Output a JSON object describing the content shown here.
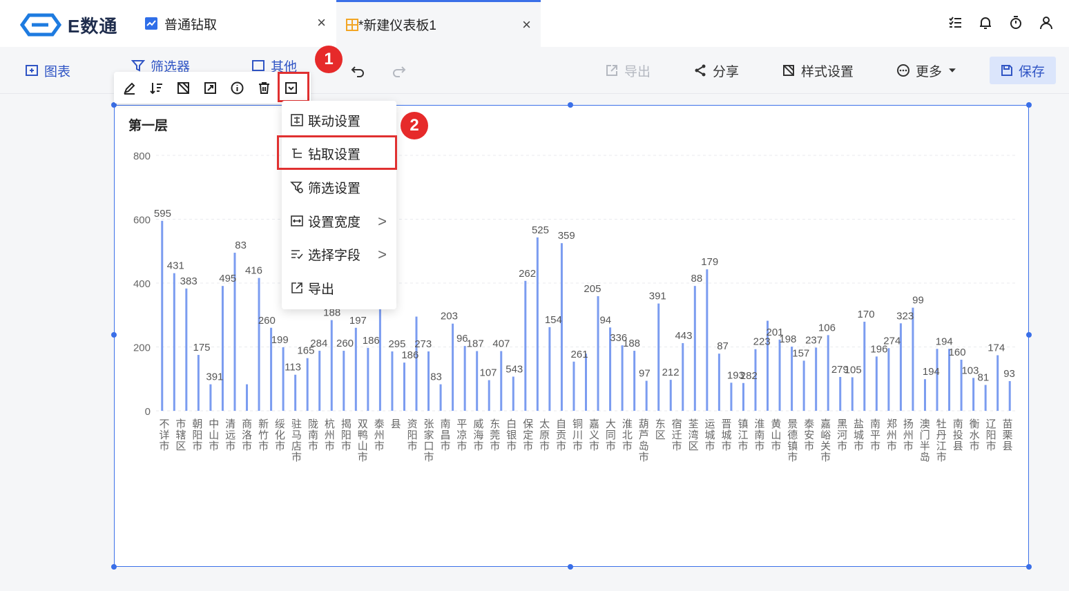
{
  "app": {
    "logo_text": "E数通"
  },
  "tabs": [
    {
      "label": "普通钻取",
      "close": "×"
    },
    {
      "label": "*新建仪表板1",
      "close": "×"
    }
  ],
  "toolbar": {
    "chart": "图表",
    "filter": "筛选器",
    "other": "其他",
    "export": "导出",
    "share": "分享",
    "style": "样式设置",
    "more": "更多",
    "save": "保存"
  },
  "menu": {
    "items": [
      {
        "label": "联动设置",
        "submenu": false
      },
      {
        "label": "钻取设置",
        "submenu": false
      },
      {
        "label": "筛选设置",
        "submenu": false
      },
      {
        "label": "设置宽度",
        "submenu": true
      },
      {
        "label": "选择字段",
        "submenu": true
      },
      {
        "label": "导出",
        "submenu": false
      }
    ],
    "arrow": ">"
  },
  "badges": [
    "1",
    "2"
  ],
  "colors": {
    "accent": "#3a6fe8",
    "bar": "#7b9cf0",
    "highlight": "#e03030",
    "badge": "#e62a2a"
  },
  "chart_data": {
    "type": "bar",
    "title": "第一层",
    "ylim": [
      0,
      800
    ],
    "yticks": [
      0,
      200,
      400,
      600,
      800
    ],
    "grid": true,
    "categories": [
      "不详市",
      "市辖区",
      "朝阳市",
      "中山市",
      "清远市",
      "商洛市",
      "新竹市",
      "绥化市",
      "驻马店市",
      "陇南市",
      "杭州市",
      "揭阳市",
      "双鸭山市",
      "泰州市",
      "县",
      "资阳市",
      "张家口市",
      "南昌市",
      "平凉市",
      "威海市",
      "东莞市",
      "白银市",
      "保定市",
      "太原市",
      "自贡市",
      "铜川市",
      "嘉义市",
      "大同市",
      "淮北市",
      "葫芦岛市",
      "东区",
      "宿迁市",
      "荃湾区",
      "运城市",
      "晋城市",
      "镇江市",
      "淮南市",
      "黄山市",
      "景德镇市",
      "泰安市",
      "嘉峪关市",
      "黑河市",
      "盐城市",
      "南平市",
      "郑州市",
      "扬州市",
      "澳门半岛",
      "牡丹江市",
      "南投县",
      "衡水市",
      "辽阳市",
      "苗栗县"
    ],
    "values": [
      595,
      431,
      383,
      175,
      83,
      391,
      495,
      83,
      416,
      260,
      199,
      113,
      165,
      188,
      284,
      188,
      260,
      197,
      327,
      186,
      151,
      295,
      186,
      83,
      273,
      203,
      187,
      96,
      187,
      107,
      407,
      543,
      262,
      525,
      154,
      179,
      359,
      261,
      205,
      188,
      94,
      336,
      97,
      212,
      391,
      443,
      179,
      88,
      87,
      193,
      282,
      223,
      201,
      157,
      198,
      237,
      106,
      105,
      279,
      170,
      196,
      274,
      323,
      99,
      194,
      194,
      160,
      103,
      81,
      174,
      93
    ],
    "labels": [
      "595",
      "431",
      "383",
      "175",
      "391",
      "495",
      "83",
      "416",
      "260",
      "199",
      "113",
      "165",
      "284",
      "188",
      "260",
      "197",
      "186",
      "151",
      "295",
      "186",
      "273",
      "83",
      "203",
      "96",
      "187",
      "107",
      "407",
      "543",
      "262",
      "525",
      "154",
      "359",
      "261",
      "205",
      "94",
      "336",
      "188",
      "97",
      "391",
      "212",
      "443",
      "88",
      "179",
      "87",
      "193",
      "282",
      "223",
      "201",
      "198",
      "157",
      "237",
      "106",
      "279",
      "105",
      "170",
      "196",
      "274",
      "323",
      "99",
      "194",
      "194",
      "160",
      "103",
      "81",
      "174",
      "93"
    ]
  }
}
